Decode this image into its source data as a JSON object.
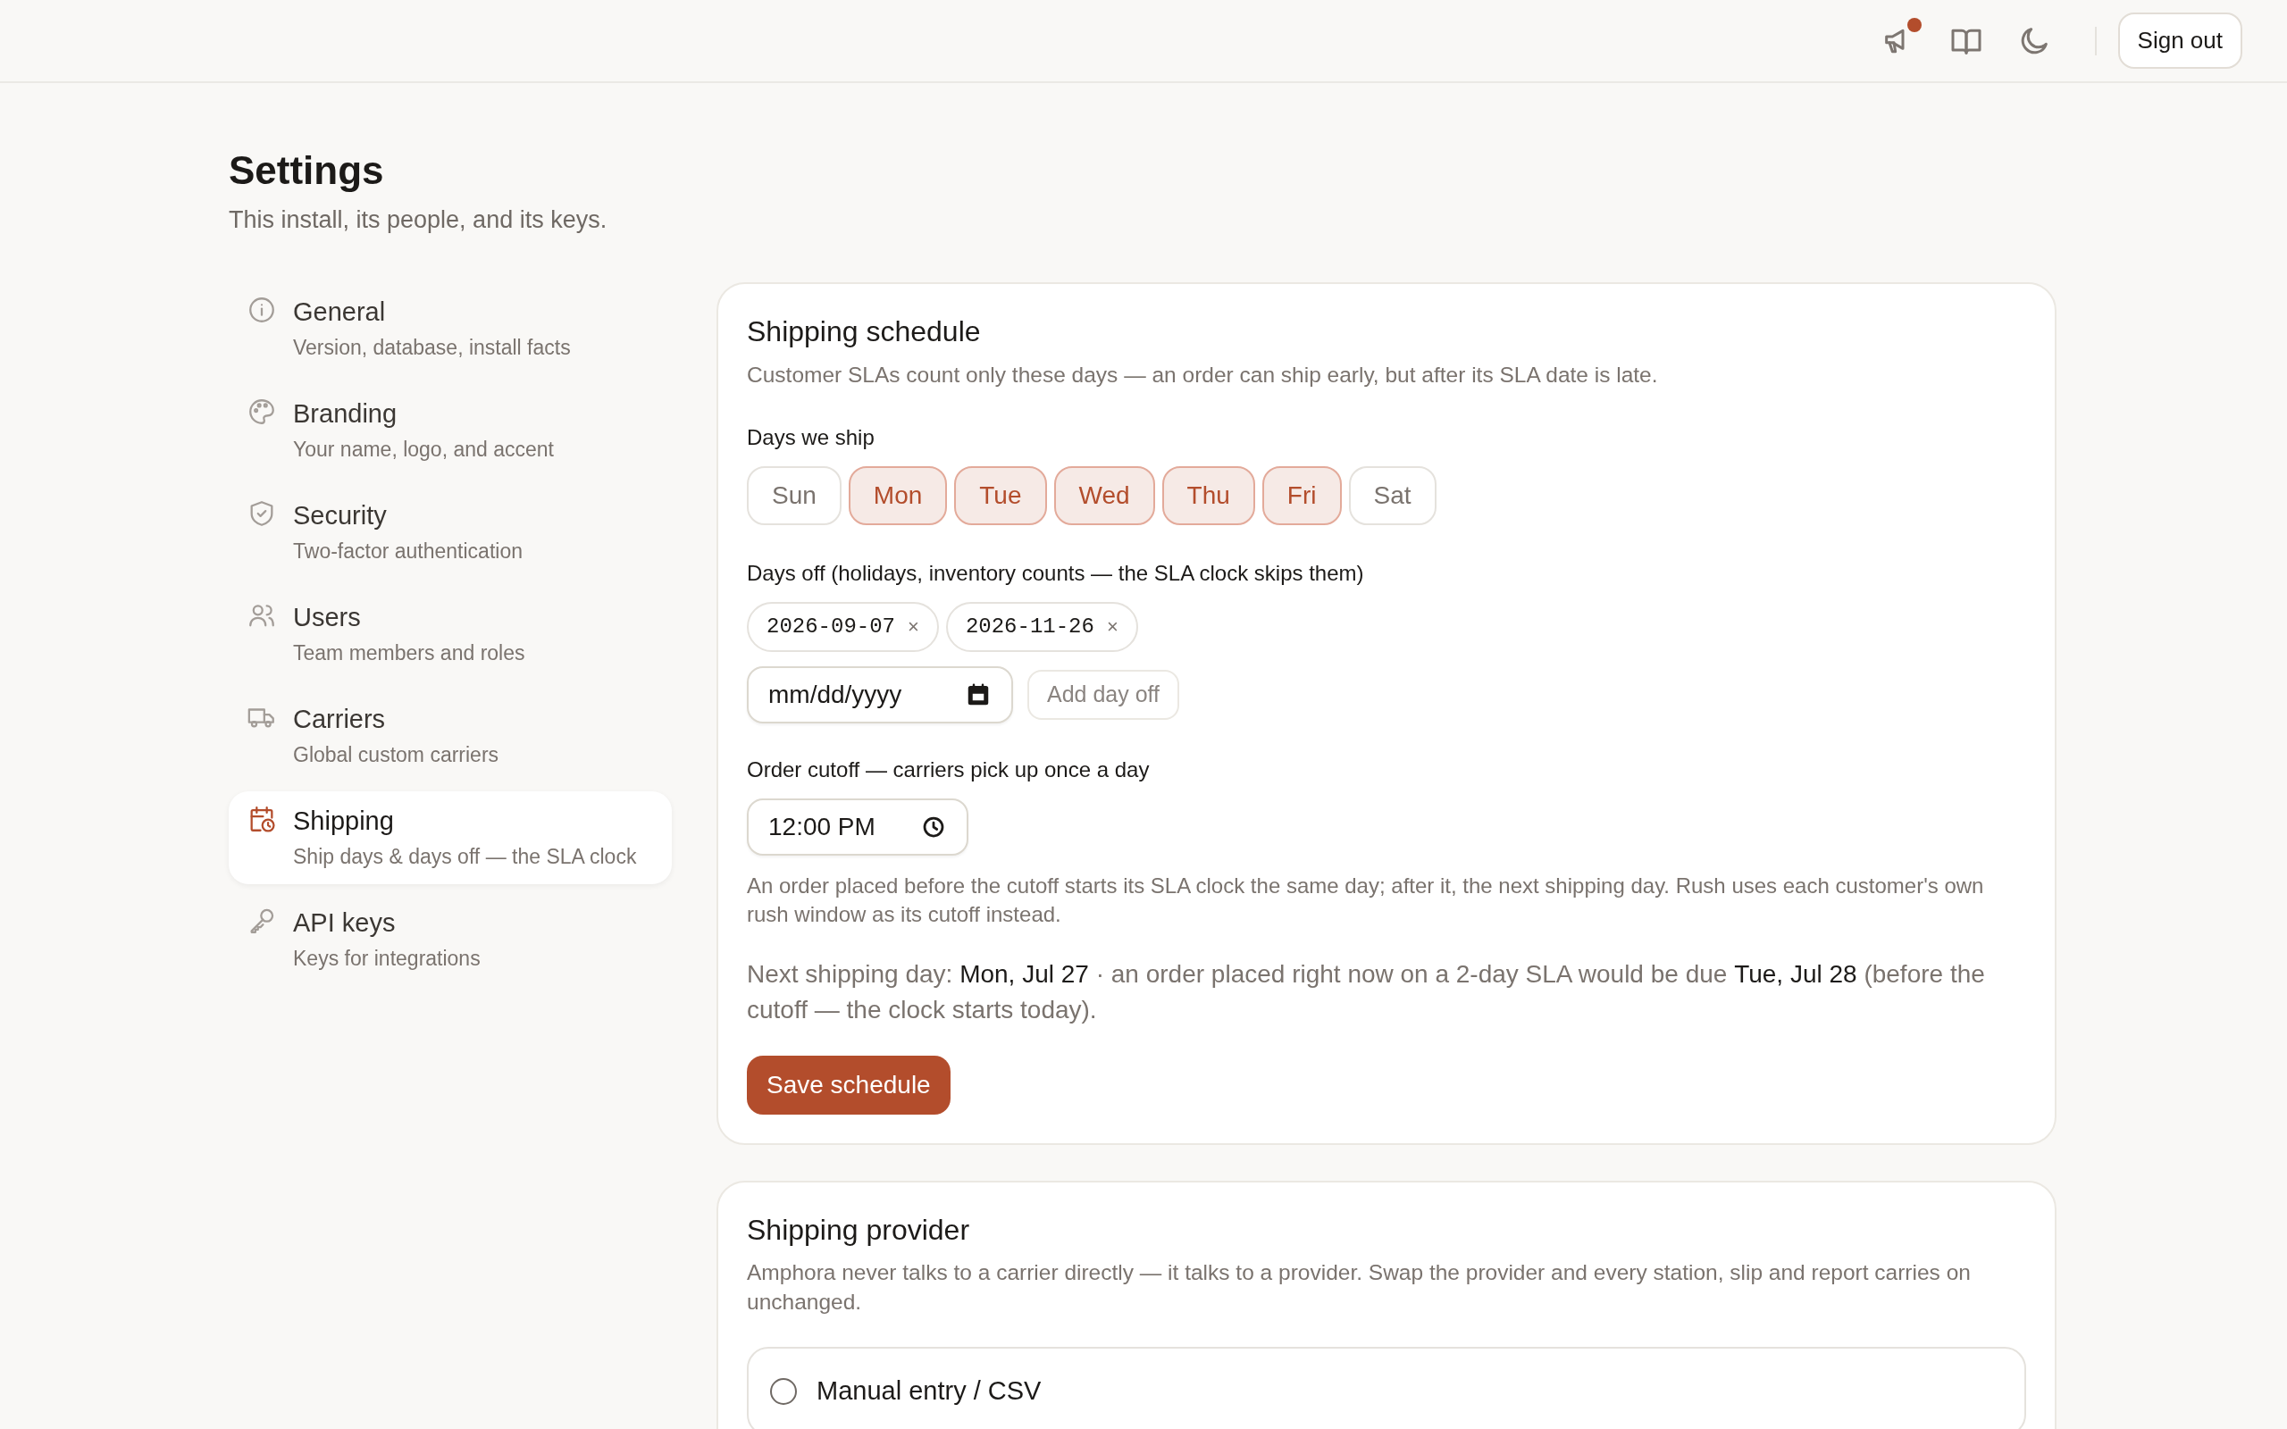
{
  "header": {
    "icons": [
      {
        "kind": "megaphone",
        "notification": true
      },
      {
        "kind": "book",
        "notification": false
      },
      {
        "kind": "moon",
        "notification": false
      }
    ],
    "sign_out": "Sign out"
  },
  "page": {
    "title": "Settings",
    "subtitle": "This install, its people, and its keys."
  },
  "sidebar": {
    "items": [
      {
        "title": "General",
        "subtitle": "Version, database, install facts",
        "selected": false
      },
      {
        "title": "Branding",
        "subtitle": "Your name, logo, and accent",
        "selected": false
      },
      {
        "title": "Security",
        "subtitle": "Two-factor authentication",
        "selected": false
      },
      {
        "title": "Users",
        "subtitle": "Team members and roles",
        "selected": false
      },
      {
        "title": "Carriers",
        "subtitle": "Global custom carriers",
        "selected": false
      },
      {
        "title": "Shipping",
        "subtitle": "Ship days & days off — the SLA clock",
        "selected": true
      },
      {
        "title": "API keys",
        "subtitle": "Keys for integrations",
        "selected": false
      }
    ]
  },
  "schedule": {
    "title": "Shipping schedule",
    "description": "Customer SLAs count only these days — an order can ship early, but after its SLA date is late.",
    "days_label": "Days we ship",
    "days": [
      {
        "label": "Sun",
        "selected": false
      },
      {
        "label": "Mon",
        "selected": true
      },
      {
        "label": "Tue",
        "selected": true
      },
      {
        "label": "Wed",
        "selected": true
      },
      {
        "label": "Thu",
        "selected": true
      },
      {
        "label": "Fri",
        "selected": true
      },
      {
        "label": "Sat",
        "selected": false
      }
    ],
    "days_off_label": "Days off (holidays, inventory counts — the SLA clock skips them)",
    "days_off": [
      {
        "date": "2026-09-07",
        "remove": "×"
      },
      {
        "date": "2026-11-26",
        "remove": "×"
      }
    ],
    "date_field": {
      "placeholder": "mm/dd/yyyy"
    },
    "add_button": {
      "label": "Add day off",
      "disabled": true
    },
    "cutoff_label": "Order cutoff — carriers pick up once a day",
    "cutoff_value": "12:00 PM",
    "cutoff_help": "An order placed before the cutoff starts its SLA clock the same day; after it, the next shipping day. Rush uses each customer's own rush window as its cutoff instead.",
    "next_day": "Next shipping day: **Mon, Jul 27** · an order placed right now on a 2-day SLA would be due **Tue, Jul 28** (before the cutoff — the clock starts today).",
    "save": "Save schedule"
  },
  "provider": {
    "title": "Shipping provider",
    "description": "Amphora never talks to a carrier directly — it talks to a provider. Swap the provider and every station, slip and report carries on unchanged.",
    "options": [
      {
        "label": "Manual entry / CSV",
        "selected": false
      }
    ]
  }
}
